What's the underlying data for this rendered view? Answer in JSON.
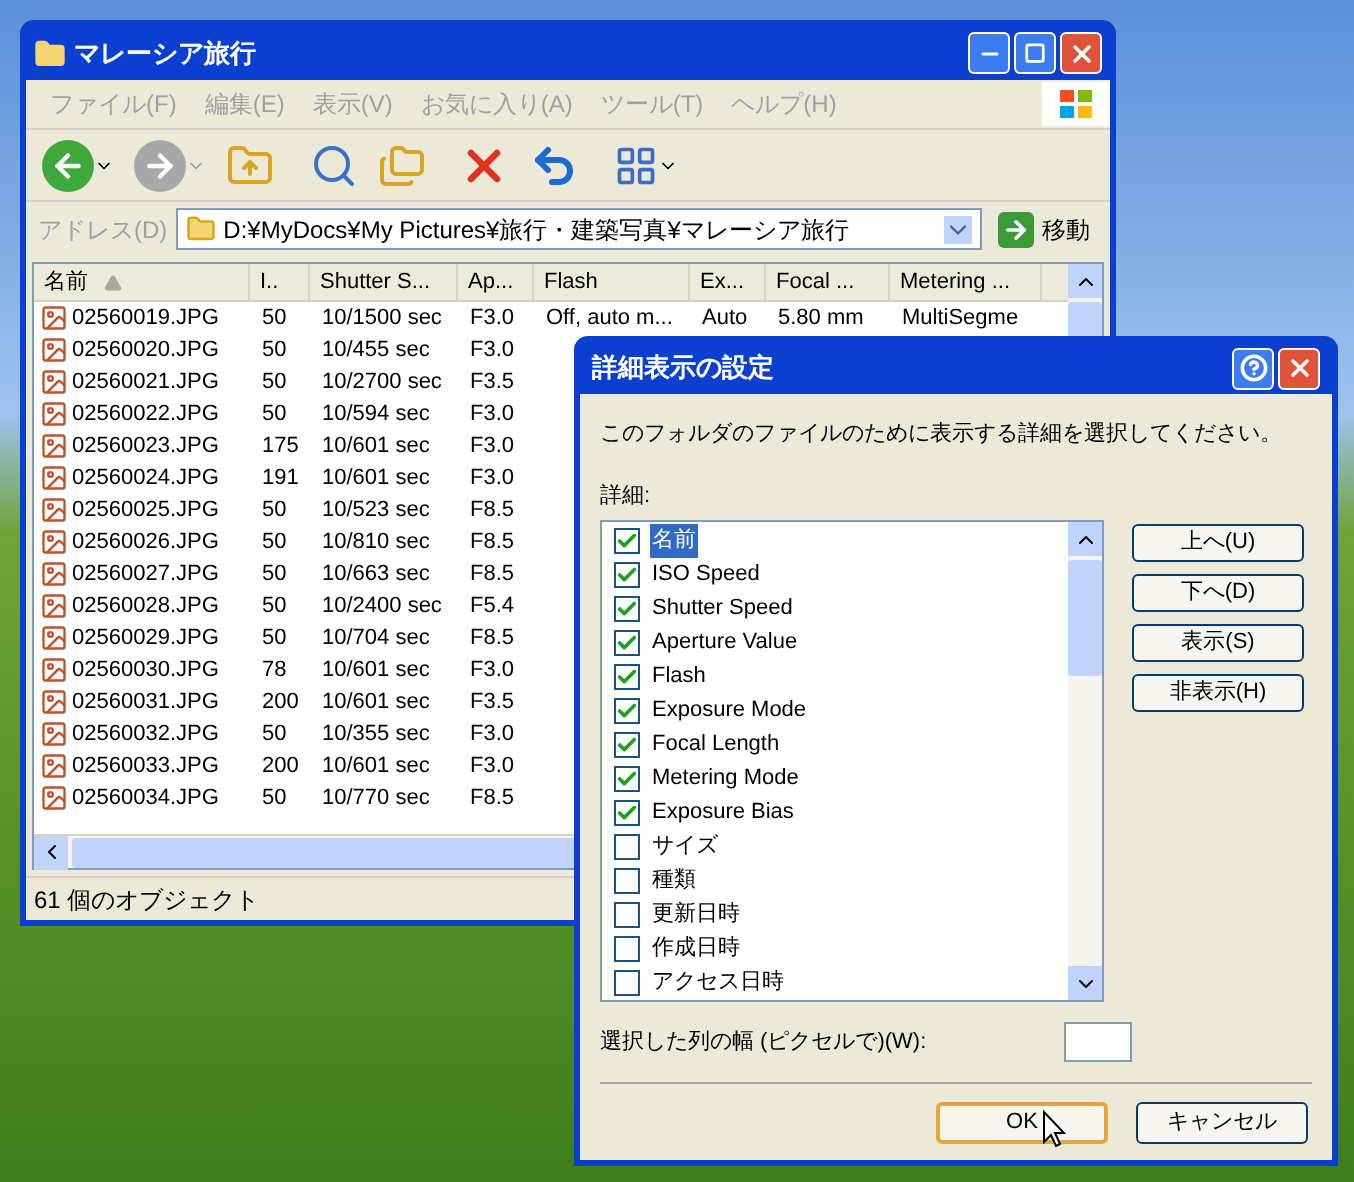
{
  "explorer": {
    "title": "マレーシア旅行",
    "menu": [
      "ファイル(F)",
      "編集(E)",
      "表示(V)",
      "お気に入り(A)",
      "ツール(T)",
      "ヘルプ(H)"
    ],
    "address": {
      "label": "アドレス(D)",
      "value": "D:¥MyDocs¥My Pictures¥旅行・建築写真¥マレーシア旅行",
      "go": "移動"
    },
    "columns": [
      {
        "label": "名前",
        "sorted": true
      },
      {
        "label": "I..",
        "sorted": false
      },
      {
        "label": "Shutter S...",
        "sorted": false
      },
      {
        "label": "Ap...",
        "sorted": false
      },
      {
        "label": "Flash",
        "sorted": false
      },
      {
        "label": "Ex...",
        "sorted": false
      },
      {
        "label": "Focal ...",
        "sorted": false
      },
      {
        "label": "Metering ...",
        "sorted": false
      }
    ],
    "rows": [
      {
        "cells": [
          "02560019.JPG",
          "50",
          "10/1500 sec",
          "F3.0",
          "Off, auto m...",
          "Auto",
          "5.80 mm",
          "MultiSegme"
        ]
      },
      {
        "cells": [
          "02560020.JPG",
          "50",
          "10/455 sec",
          "F3.0"
        ]
      },
      {
        "cells": [
          "02560021.JPG",
          "50",
          "10/2700 sec",
          "F3.5"
        ]
      },
      {
        "cells": [
          "02560022.JPG",
          "50",
          "10/594 sec",
          "F3.0"
        ]
      },
      {
        "cells": [
          "02560023.JPG",
          "175",
          "10/601 sec",
          "F3.0"
        ]
      },
      {
        "cells": [
          "02560024.JPG",
          "191",
          "10/601 sec",
          "F3.0"
        ]
      },
      {
        "cells": [
          "02560025.JPG",
          "50",
          "10/523 sec",
          "F8.5"
        ]
      },
      {
        "cells": [
          "02560026.JPG",
          "50",
          "10/810 sec",
          "F8.5"
        ]
      },
      {
        "cells": [
          "02560027.JPG",
          "50",
          "10/663 sec",
          "F8.5"
        ]
      },
      {
        "cells": [
          "02560028.JPG",
          "50",
          "10/2400 sec",
          "F5.4"
        ]
      },
      {
        "cells": [
          "02560029.JPG",
          "50",
          "10/704 sec",
          "F8.5"
        ]
      },
      {
        "cells": [
          "02560030.JPG",
          "78",
          "10/601 sec",
          "F3.0"
        ]
      },
      {
        "cells": [
          "02560031.JPG",
          "200",
          "10/601 sec",
          "F3.5"
        ]
      },
      {
        "cells": [
          "02560032.JPG",
          "50",
          "10/355 sec",
          "F3.0"
        ]
      },
      {
        "cells": [
          "02560033.JPG",
          "200",
          "10/601 sec",
          "F3.0"
        ]
      },
      {
        "cells": [
          "02560034.JPG",
          "50",
          "10/770 sec",
          "F8.5"
        ]
      }
    ],
    "status": "61 個のオブジェクト"
  },
  "dialog": {
    "title": "詳細表示の設定",
    "description": "このフォルダのファイルのために表示する詳細を選択してください。",
    "list_label": "詳細:",
    "items": [
      {
        "label": "名前",
        "checked": true,
        "selected": true
      },
      {
        "label": "ISO Speed",
        "checked": true,
        "selected": false
      },
      {
        "label": "Shutter Speed",
        "checked": true,
        "selected": false
      },
      {
        "label": "Aperture Value",
        "checked": true,
        "selected": false
      },
      {
        "label": "Flash",
        "checked": true,
        "selected": false
      },
      {
        "label": "Exposure Mode",
        "checked": true,
        "selected": false
      },
      {
        "label": "Focal Length",
        "checked": true,
        "selected": false
      },
      {
        "label": "Metering Mode",
        "checked": true,
        "selected": false
      },
      {
        "label": "Exposure Bias",
        "checked": true,
        "selected": false
      },
      {
        "label": "サイズ",
        "checked": false,
        "selected": false
      },
      {
        "label": "種類",
        "checked": false,
        "selected": false
      },
      {
        "label": "更新日時",
        "checked": false,
        "selected": false
      },
      {
        "label": "作成日時",
        "checked": false,
        "selected": false
      },
      {
        "label": "アクセス日時",
        "checked": false,
        "selected": false
      }
    ],
    "side_buttons": [
      "上へ(U)",
      "下へ(D)",
      "表示(S)",
      "非表示(H)"
    ],
    "width_label": "選択した列の幅 (ピクセルで)(W):",
    "footer_buttons": [
      {
        "label": "OK",
        "focused": true
      },
      {
        "label": "キャンセル",
        "focused": false
      }
    ]
  }
}
